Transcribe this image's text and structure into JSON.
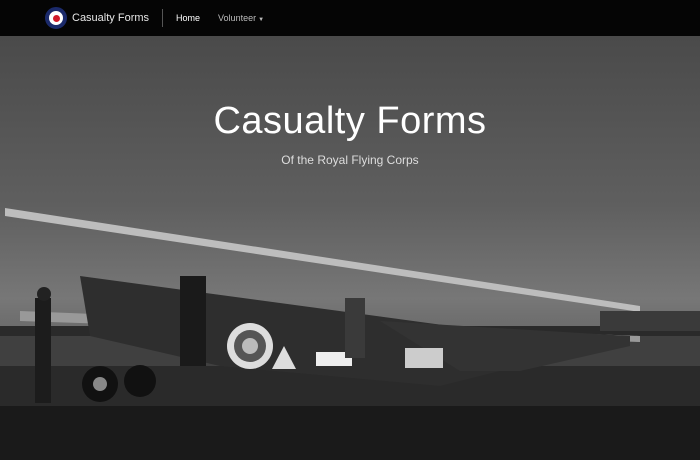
{
  "nav": {
    "brand": "Casualty Forms",
    "items": [
      {
        "label": "Home"
      },
      {
        "label": "Volunteer",
        "has_dropdown": true
      }
    ]
  },
  "hero": {
    "title": "Casualty Forms",
    "subtitle": "Of the Royal Flying Corps"
  },
  "colors": {
    "roundel_blue": "#1b2a6b",
    "roundel_red": "#d11a2a",
    "navbar": "#050505"
  }
}
